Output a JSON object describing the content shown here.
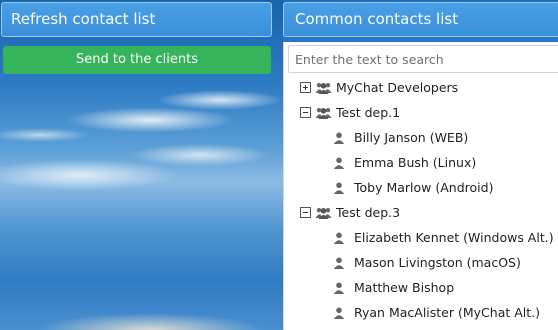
{
  "header": {
    "refresh_label": "Refresh contact list",
    "common_label": "Common contacts list"
  },
  "actions": {
    "send_label": "Send to the clients"
  },
  "search": {
    "placeholder": "Enter the text to search"
  },
  "tree": {
    "groups": [
      {
        "label": "MyChat Developers",
        "expanded": false,
        "members": []
      },
      {
        "label": "Test dep.1",
        "expanded": true,
        "members": [
          "Billy Janson (WEB)",
          "Emma Bush (Linux)",
          "Toby Marlow (Android)"
        ]
      },
      {
        "label": "Test dep.3",
        "expanded": true,
        "members": [
          "Elizabeth Kennet (Windows Alt.)",
          "Mason Livingston (macOS)",
          "Matthew Bishop",
          "Ryan MacAlister (MyChat Alt.)"
        ]
      }
    ]
  },
  "colors": {
    "header_blue": "#3a8fd9",
    "send_green": "#35b45b",
    "icon_gray": "#666666"
  }
}
